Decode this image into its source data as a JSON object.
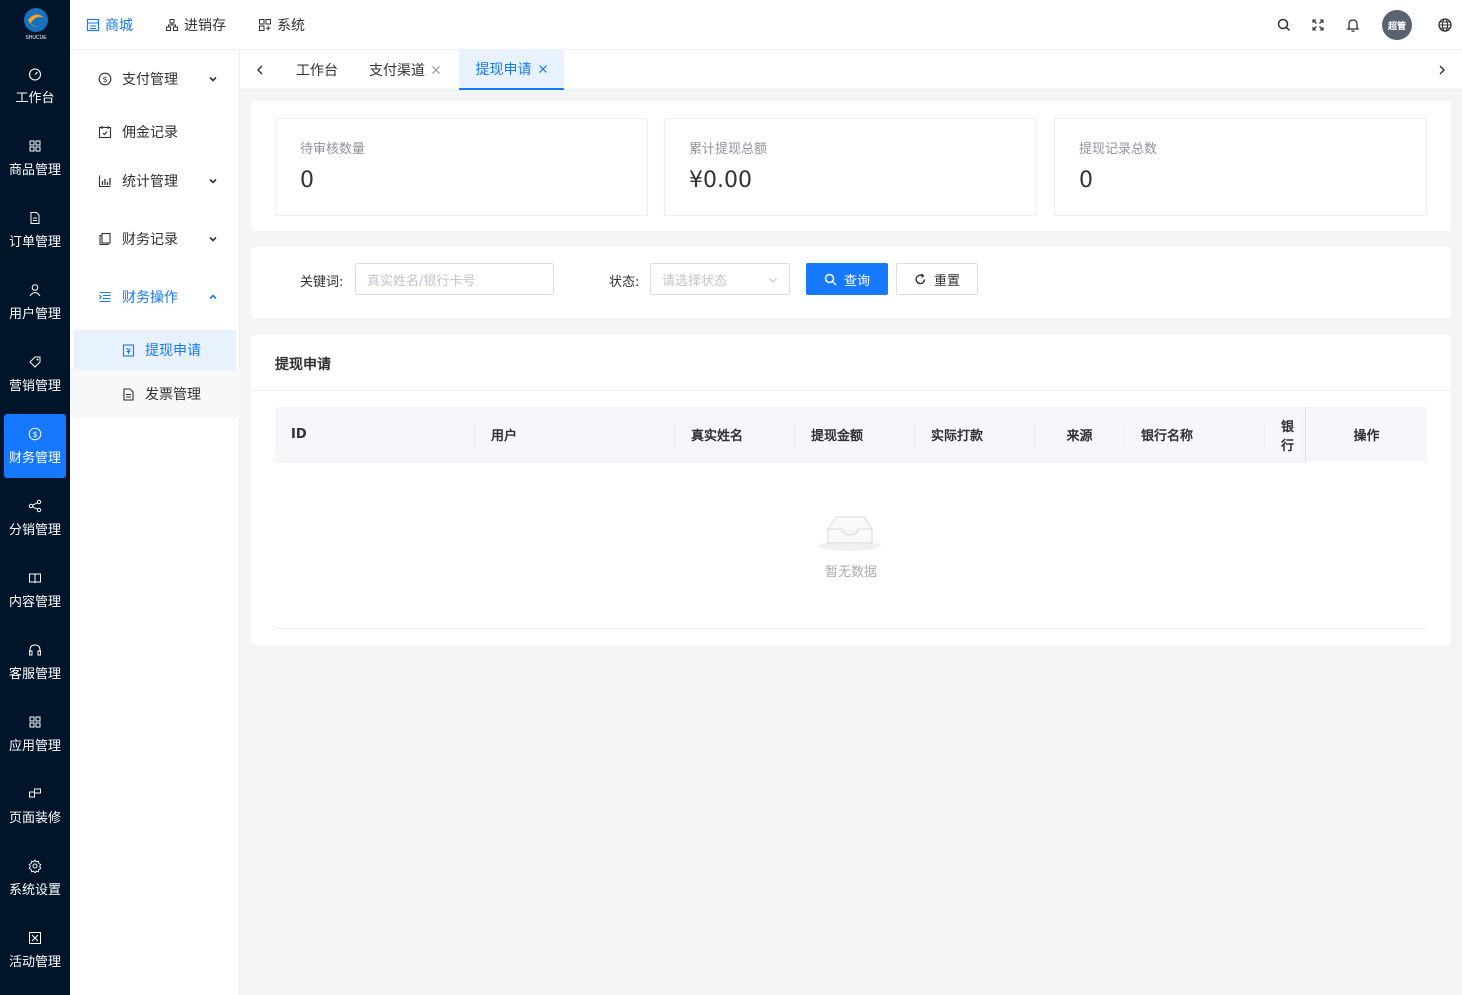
{
  "brand": {
    "logo_text": "SHUCUE"
  },
  "sidebar": {
    "items": [
      {
        "label": "工作台",
        "icon": "dashboard-icon"
      },
      {
        "label": "商品管理",
        "icon": "grid-icon"
      },
      {
        "label": "订单管理",
        "icon": "file-icon"
      },
      {
        "label": "用户管理",
        "icon": "user-icon"
      },
      {
        "label": "营销管理",
        "icon": "tag-icon"
      },
      {
        "label": "财务管理",
        "icon": "dollar-icon",
        "active": true
      },
      {
        "label": "分销管理",
        "icon": "share-icon"
      },
      {
        "label": "内容管理",
        "icon": "book-icon"
      },
      {
        "label": "客服管理",
        "icon": "headset-icon"
      },
      {
        "label": "应用管理",
        "icon": "apps-icon"
      },
      {
        "label": "页面装修",
        "icon": "layout-icon"
      },
      {
        "label": "系统设置",
        "icon": "gear-icon"
      },
      {
        "label": "活动管理",
        "icon": "activity-icon"
      }
    ]
  },
  "header": {
    "nav": [
      {
        "label": "商城",
        "icon": "shop-icon",
        "active": true
      },
      {
        "label": "进销存",
        "icon": "inventory-icon"
      },
      {
        "label": "系统",
        "icon": "system-icon"
      }
    ],
    "avatar_text": "超管"
  },
  "submenu": {
    "groups": [
      {
        "label": "支付管理",
        "icon": "dollar-circle-icon"
      },
      {
        "label": "佣金记录",
        "icon": "calendar-icon"
      },
      {
        "label": "统计管理",
        "icon": "bar-chart-icon"
      },
      {
        "label": "财务记录",
        "icon": "copy-icon"
      },
      {
        "label": "财务操作",
        "icon": "list-icon",
        "open": true
      }
    ],
    "children": [
      {
        "label": "提现申请",
        "icon": "withdraw-icon",
        "active": true
      },
      {
        "label": "发票管理",
        "icon": "invoice-icon"
      }
    ]
  },
  "tabs": [
    {
      "label": "工作台"
    },
    {
      "label": "支付渠道"
    },
    {
      "label": "提现申请",
      "active": true
    }
  ],
  "stats": [
    {
      "label": "待审核数量",
      "value": "0"
    },
    {
      "label": "累计提现总额",
      "value": "¥0.00"
    },
    {
      "label": "提现记录总数",
      "value": "0"
    }
  ],
  "filter": {
    "keyword_label": "关键词:",
    "keyword_placeholder": "真实姓名/银行卡号",
    "status_label": "状态:",
    "status_placeholder": "请选择状态",
    "search_label": "查询",
    "reset_label": "重置"
  },
  "table": {
    "title": "提现申请",
    "columns": [
      "ID",
      "用户",
      "真实姓名",
      "提现金额",
      "实际打款",
      "来源",
      "银行名称",
      "银行",
      "操作"
    ],
    "rows": [],
    "empty_text": "暂无数据"
  },
  "colors": {
    "primary": "#1677ff",
    "sidebar_bg": "#001529"
  }
}
